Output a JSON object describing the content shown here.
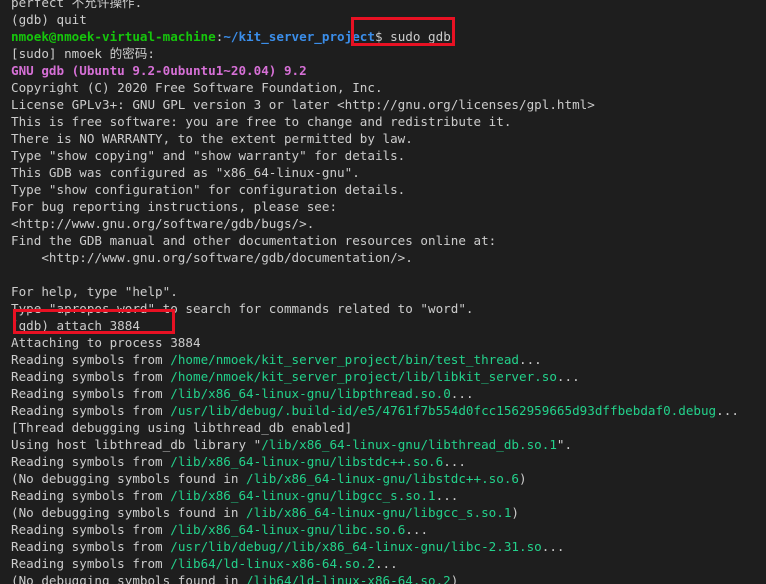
{
  "terminal": {
    "lines": [
      {
        "segments": [
          {
            "text": "perfect 不允许操作."
          }
        ]
      },
      {
        "segments": [
          {
            "text": "(gdb) quit"
          }
        ]
      },
      {
        "segments": [
          {
            "text": "nmoek@nmoek-virtual-machine",
            "style": "user"
          },
          {
            "text": ":"
          },
          {
            "text": "~/kit_server_project",
            "style": "path"
          },
          {
            "text": "$ sudo gdb"
          }
        ]
      },
      {
        "segments": [
          {
            "text": "[sudo] nmoek 的密码:"
          }
        ]
      },
      {
        "segments": [
          {
            "text": "GNU gdb (Ubuntu 9.2-0ubuntu1~20.04) 9.2",
            "style": "magenta"
          }
        ]
      },
      {
        "segments": [
          {
            "text": "Copyright (C) 2020 Free Software Foundation, Inc."
          }
        ]
      },
      {
        "segments": [
          {
            "text": "License GPLv3+: GNU GPL version 3 or later <http://gnu.org/licenses/gpl.html>"
          }
        ]
      },
      {
        "segments": [
          {
            "text": "This is free software: you are free to change and redistribute it."
          }
        ]
      },
      {
        "segments": [
          {
            "text": "There is NO WARRANTY, to the extent permitted by law."
          }
        ]
      },
      {
        "segments": [
          {
            "text": "Type \"show copying\" and \"show warranty\" for details."
          }
        ]
      },
      {
        "segments": [
          {
            "text": "This GDB was configured as \"x86_64-linux-gnu\"."
          }
        ]
      },
      {
        "segments": [
          {
            "text": "Type \"show configuration\" for configuration details."
          }
        ]
      },
      {
        "segments": [
          {
            "text": "For bug reporting instructions, please see:"
          }
        ]
      },
      {
        "segments": [
          {
            "text": "<http://www.gnu.org/software/gdb/bugs/>."
          }
        ]
      },
      {
        "segments": [
          {
            "text": "Find the GDB manual and other documentation resources online at:"
          }
        ]
      },
      {
        "segments": [
          {
            "text": "    <http://www.gnu.org/software/gdb/documentation/>."
          }
        ]
      },
      {
        "segments": [
          {
            "text": ""
          }
        ]
      },
      {
        "segments": [
          {
            "text": "For help, type \"help\"."
          }
        ]
      },
      {
        "segments": [
          {
            "text": "Type \"apropos word\" to search for commands related to \"word\"."
          }
        ]
      },
      {
        "segments": [
          {
            "text": "(gdb) attach 3884"
          }
        ]
      },
      {
        "segments": [
          {
            "text": "Attaching to process 3884"
          }
        ]
      },
      {
        "segments": [
          {
            "text": "Reading symbols from "
          },
          {
            "text": "/home/nmoek/kit_server_project/bin/test_thread",
            "style": "green"
          },
          {
            "text": "..."
          }
        ]
      },
      {
        "segments": [
          {
            "text": "Reading symbols from "
          },
          {
            "text": "/home/nmoek/kit_server_project/lib/libkit_server.so",
            "style": "green"
          },
          {
            "text": "..."
          }
        ]
      },
      {
        "segments": [
          {
            "text": "Reading symbols from "
          },
          {
            "text": "/lib/x86_64-linux-gnu/libpthread.so.0",
            "style": "green"
          },
          {
            "text": "..."
          }
        ]
      },
      {
        "segments": [
          {
            "text": "Reading symbols from "
          },
          {
            "text": "/usr/lib/debug/.build-id/e5/4761f7b554d0fcc1562959665d93dffbebdaf0.debug",
            "style": "green"
          },
          {
            "text": "..."
          }
        ]
      },
      {
        "segments": [
          {
            "text": "[Thread debugging using libthread_db enabled]"
          }
        ]
      },
      {
        "segments": [
          {
            "text": "Using host libthread_db library \""
          },
          {
            "text": "/lib/x86_64-linux-gnu/libthread_db.so.1",
            "style": "green"
          },
          {
            "text": "\"."
          }
        ]
      },
      {
        "segments": [
          {
            "text": "Reading symbols from "
          },
          {
            "text": "/lib/x86_64-linux-gnu/libstdc++.so.6",
            "style": "green"
          },
          {
            "text": "..."
          }
        ]
      },
      {
        "segments": [
          {
            "text": "(No debugging symbols found in "
          },
          {
            "text": "/lib/x86_64-linux-gnu/libstdc++.so.6",
            "style": "green"
          },
          {
            "text": ")"
          }
        ]
      },
      {
        "segments": [
          {
            "text": "Reading symbols from "
          },
          {
            "text": "/lib/x86_64-linux-gnu/libgcc_s.so.1",
            "style": "green"
          },
          {
            "text": "..."
          }
        ]
      },
      {
        "segments": [
          {
            "text": "(No debugging symbols found in "
          },
          {
            "text": "/lib/x86_64-linux-gnu/libgcc_s.so.1",
            "style": "green"
          },
          {
            "text": ")"
          }
        ]
      },
      {
        "segments": [
          {
            "text": "Reading symbols from "
          },
          {
            "text": "/lib/x86_64-linux-gnu/libc.so.6",
            "style": "green"
          },
          {
            "text": "..."
          }
        ]
      },
      {
        "segments": [
          {
            "text": "Reading symbols from "
          },
          {
            "text": "/usr/lib/debug//lib/x86_64-linux-gnu/libc-2.31.so",
            "style": "green"
          },
          {
            "text": "..."
          }
        ]
      },
      {
        "segments": [
          {
            "text": "Reading symbols from "
          },
          {
            "text": "/lib64/ld-linux-x86-64.so.2",
            "style": "green"
          },
          {
            "text": "..."
          }
        ]
      },
      {
        "segments": [
          {
            "text": "(No debugging symbols found in "
          },
          {
            "text": "/lib64/ld-linux-x86-64.so.2",
            "style": "green"
          },
          {
            "text": ")"
          }
        ]
      }
    ]
  },
  "colors": {
    "background": "#1e1e1e",
    "text": "#cccccc",
    "user": "#16c60c",
    "path": "#3b8eea",
    "banner": "#d670d6",
    "file_path": "#23d18b",
    "highlight_box": "#e81123"
  }
}
